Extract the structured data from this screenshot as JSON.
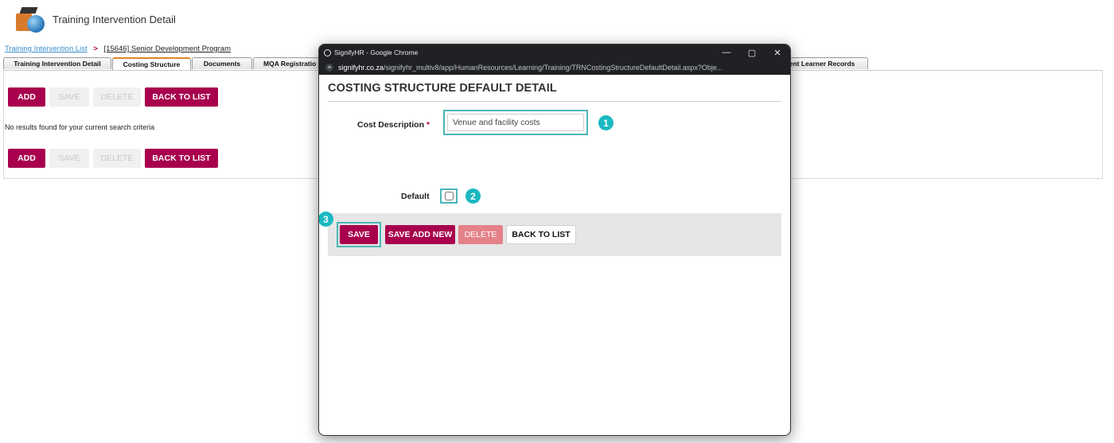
{
  "header": {
    "title": "Training Intervention Detail",
    "logo": "training-logo-icon"
  },
  "breadcrumb": {
    "list_link": "Training Intervention List",
    "separator": ">",
    "current": "[15646] Senior Development Program"
  },
  "tabs": [
    {
      "label": "Training Intervention Detail",
      "active": false
    },
    {
      "label": "Costing Structure",
      "active": true
    },
    {
      "label": "Documents",
      "active": false
    },
    {
      "label": "MQA Registratio",
      "active": false
    }
  ],
  "tab_right_label": "vent Learner Records",
  "toolbar": {
    "add": "ADD",
    "save": "SAVE",
    "delete": "DELETE",
    "back": "BACK TO LIST"
  },
  "no_results_text": "No results found for your current search criteria",
  "popup": {
    "window_title": "SignifyHR - Google Chrome",
    "url_host": "signifyhr.co.za",
    "url_path": "/signifyhr_multiv8/app/HumanResources/Learning/Training/TRNCostingStructureDefaultDetail.aspx?Obje...",
    "heading": "COSTING STRUCTURE DEFAULT DETAIL",
    "cost_description_label": "Cost Description",
    "required_marker": "*",
    "cost_description_value": "Venue and facility costs",
    "default_label": "Default",
    "default_checked": false,
    "buttons": {
      "save": "SAVE",
      "save_add_new": "SAVE ADD NEW",
      "delete": "DELETE",
      "back": "BACK TO LIST"
    },
    "callouts": {
      "one": "1",
      "two": "2",
      "three": "3"
    },
    "window_controls": {
      "minimize": "—",
      "maximize": "▢",
      "close": "✕"
    }
  },
  "colors": {
    "brand": "#a8004d",
    "highlight": "#4cb6b6",
    "callout": "#1bb8c1",
    "tab_accent": "#e0862a"
  }
}
